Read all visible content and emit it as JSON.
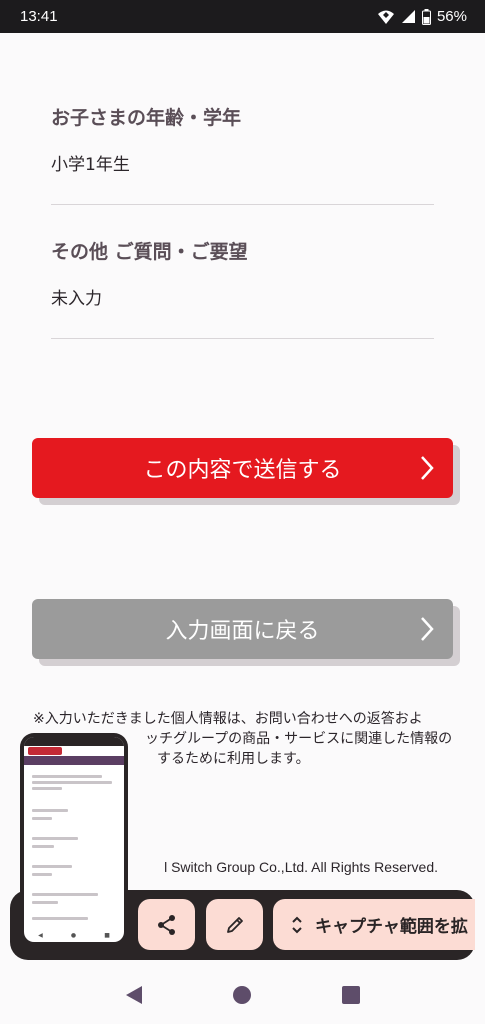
{
  "status": {
    "time": "13:41",
    "battery": "56%"
  },
  "fields": [
    {
      "label": "お子さまの年齢・学年",
      "value": "小学1年生"
    },
    {
      "label": "その他 ご質問・ご要望",
      "value": "未入力"
    }
  ],
  "buttons": {
    "submit_label": "この内容で送信する",
    "back_label": "入力画面に戻る"
  },
  "notice": "※入力いただきました個人情報は、お問い合わせへの返答およびZ会グループ・Switchグループの商品・サービスに関連した情報のご案内をするために利用します。",
  "notice_visible": {
    "line1": "※入力いただきました個人情報は、お問い合わせへの返答およ",
    "line2": "ッチグループの商品・サービスに関連した情報の",
    "line3": "するために利用します。"
  },
  "copyright": "l Switch Group Co.,Ltd. All Rights Reserved.",
  "capture": {
    "range_label": "キャプチャ範囲を拡"
  },
  "colors": {
    "submit": "#e5191f",
    "back": "#9b9b9b",
    "label": "#5a4e57",
    "capture_bg": "#2a2526",
    "capture_btn": "#fcdcd4"
  },
  "icons": {
    "share": "share-icon",
    "edit": "pencil-icon",
    "range": "expand-vertical-icon",
    "chevron": "chevron-right-icon"
  }
}
